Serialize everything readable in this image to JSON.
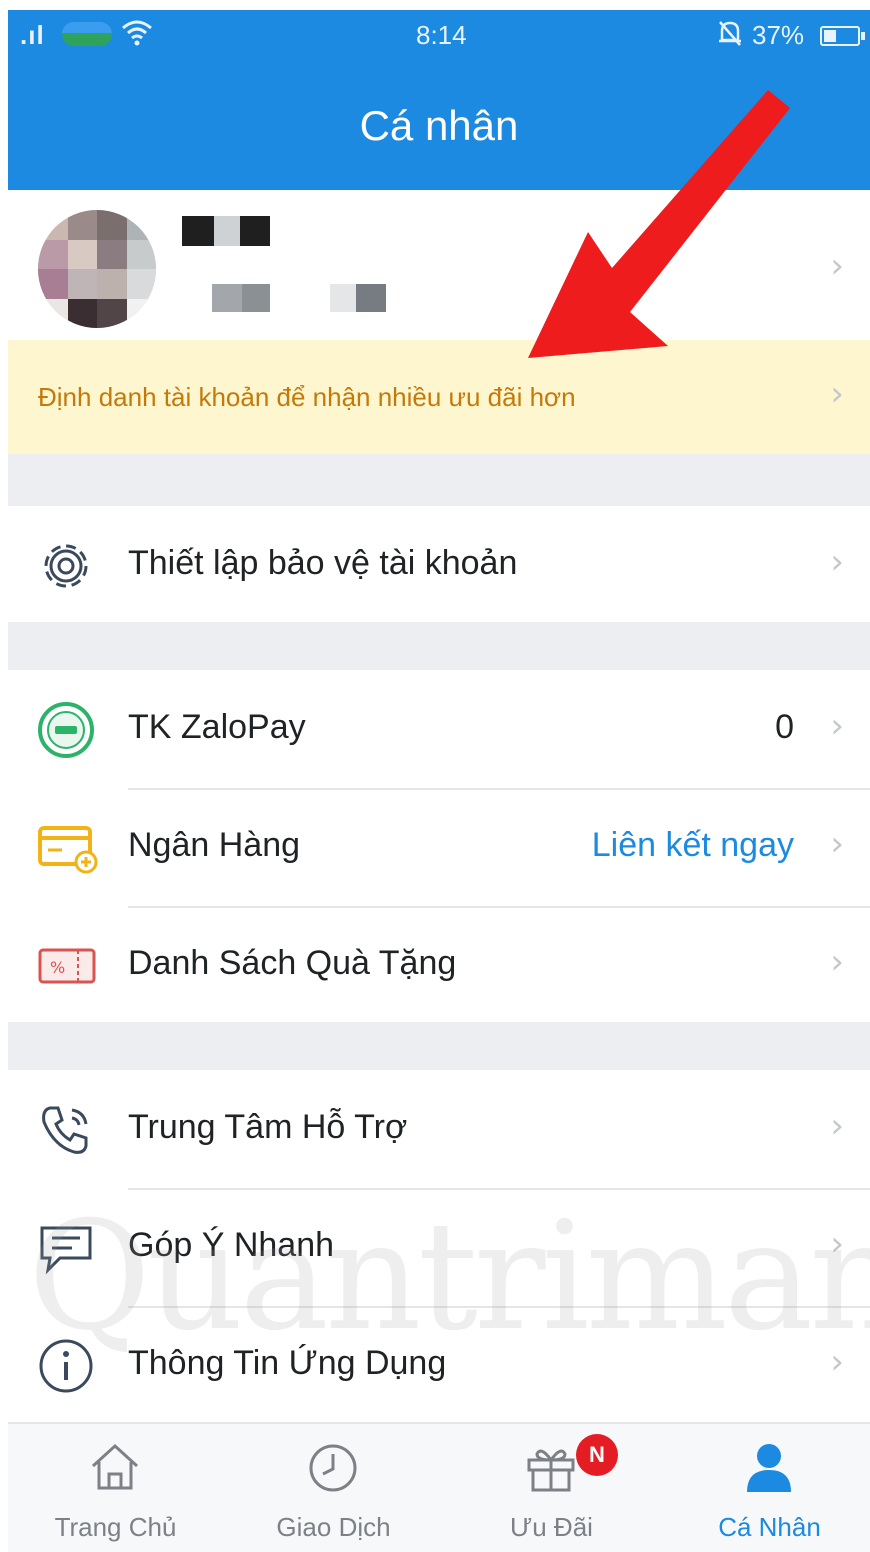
{
  "status_bar": {
    "signal": ".ıl",
    "time": "8:14",
    "battery_percent": "37%",
    "battery_level": 0.37
  },
  "header": {
    "title": "Cá nhân"
  },
  "banner": {
    "text": "Định danh tài khoản để nhận nhiều ưu đãi hơn"
  },
  "security": {
    "label": "Thiết lập bảo vệ tài khoản"
  },
  "wallet": {
    "items": [
      {
        "label": "TK ZaloPay",
        "value": "0"
      },
      {
        "label": "Ngân Hàng",
        "value": "Liên kết ngay"
      },
      {
        "label": "Danh Sách Quà Tặng",
        "value": ""
      }
    ]
  },
  "support": {
    "items": [
      {
        "label": "Trung Tâm Hỗ Trợ"
      },
      {
        "label": "Góp Ý Nhanh"
      },
      {
        "label": "Thông Tin Ứng Dụng"
      }
    ]
  },
  "tabs": [
    {
      "label": "Trang Chủ",
      "icon": "home-icon"
    },
    {
      "label": "Giao Dịch",
      "icon": "clock-icon"
    },
    {
      "label": "Ưu Đãi",
      "icon": "gift-icon",
      "badge": "N"
    },
    {
      "label": "Cá Nhân",
      "icon": "user-icon",
      "active": true
    }
  ],
  "watermark": "Quantrimang",
  "colors": {
    "primary": "#1b8ae0",
    "banner_bg": "#fdf6cf",
    "banner_text": "#c47a0a",
    "link": "#1b8ae0",
    "badge": "#e41c23",
    "arrow": "#ee1c1c"
  }
}
